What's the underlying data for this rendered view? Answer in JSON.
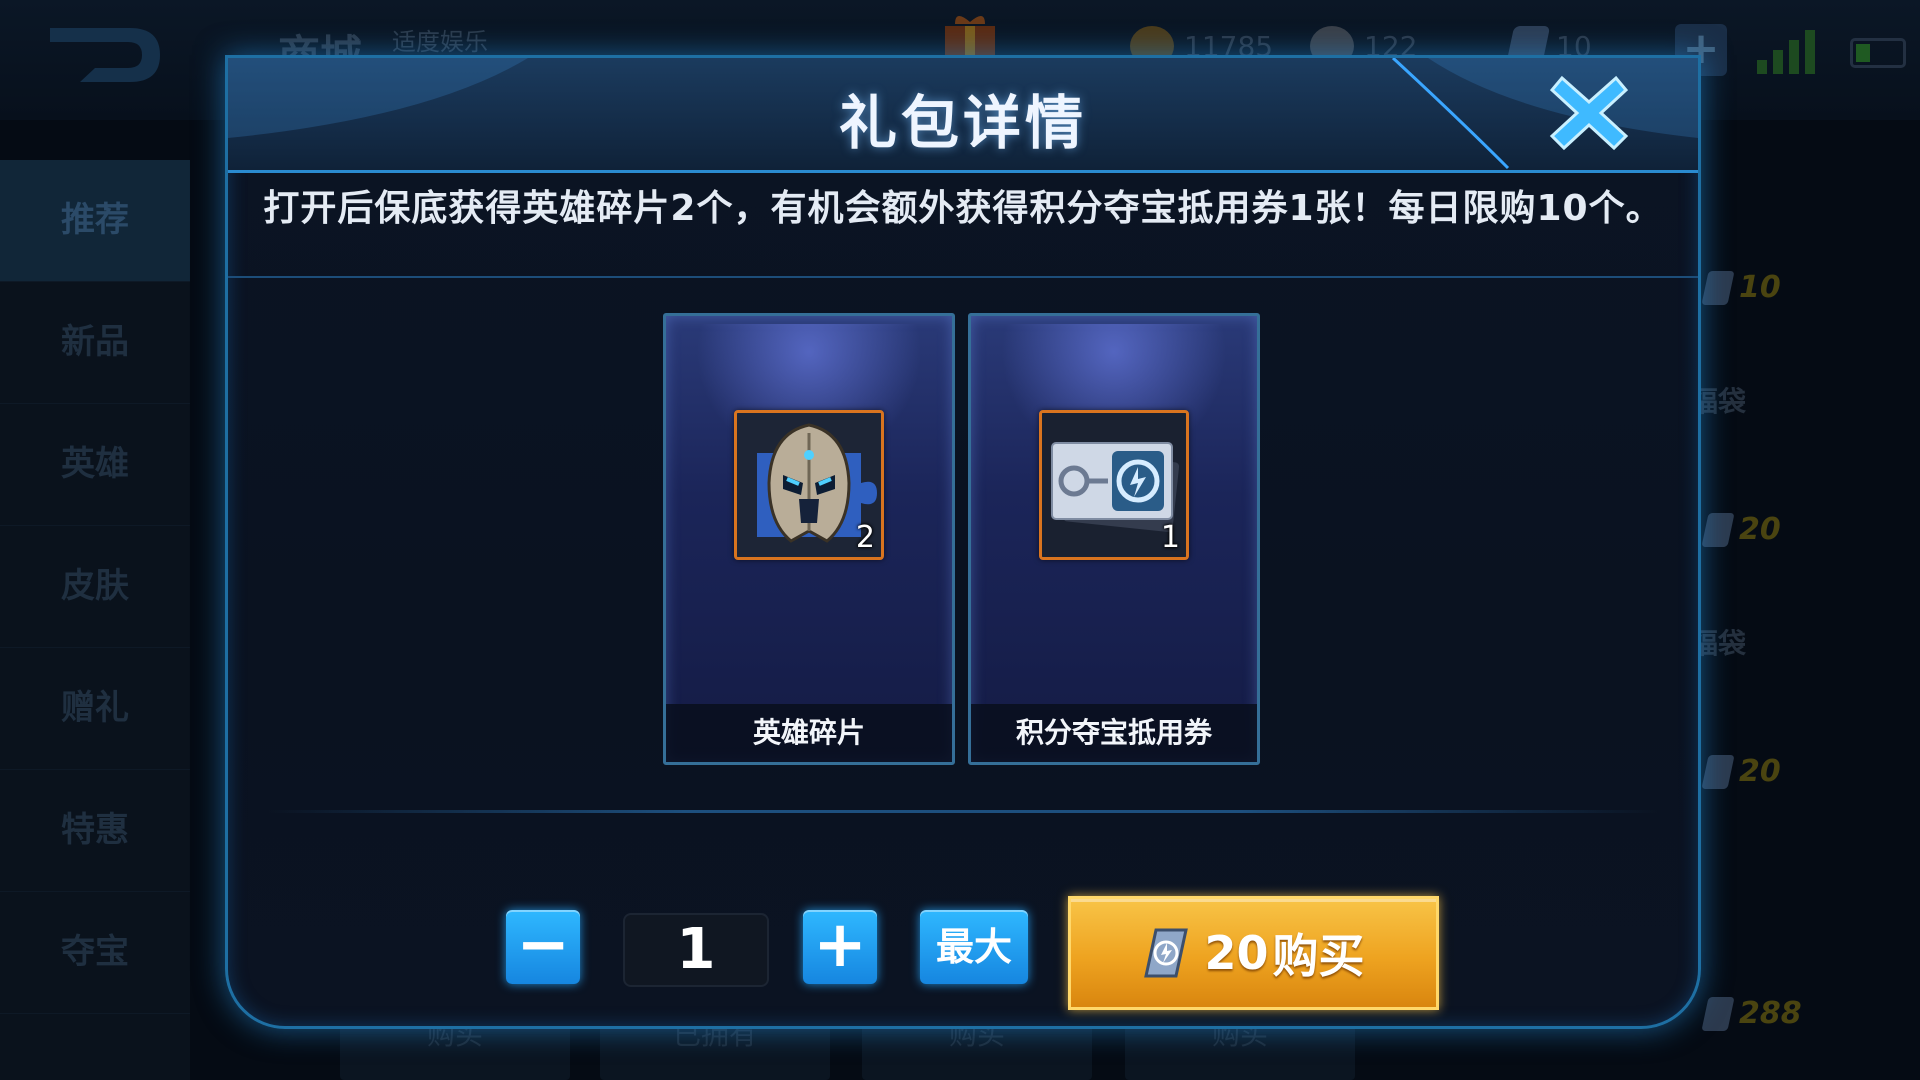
{
  "background": {
    "shop_title": "商城",
    "shop_subtitle": "适度娱乐",
    "resources": [
      {
        "icon": "gold-coin-icon",
        "value": "11785"
      },
      {
        "icon": "skull-icon",
        "value": "122"
      },
      {
        "icon": "ticket-icon",
        "value": "10"
      }
    ],
    "sidebar": [
      "推荐",
      "新品",
      "英雄",
      "皮肤",
      "赠礼",
      "特惠",
      "夺宝"
    ],
    "sidebar_active": "推荐",
    "right_prices": [
      "10",
      "20",
      "20",
      "288"
    ],
    "right_bags": [
      "福袋",
      "福袋"
    ],
    "bottom_tabs": [
      "购买",
      "已拥有",
      "购买",
      "购买"
    ]
  },
  "modal": {
    "title": "礼包详情",
    "description": "打开后保底获得英雄碎片2个，有机会额外获得积分夺宝抵用券1张！每日限购10个。",
    "items": [
      {
        "name": "英雄碎片",
        "count": "2",
        "icon": "hero-fragment-helmet-icon"
      },
      {
        "name": "积分夺宝抵用券",
        "count": "1",
        "icon": "lottery-voucher-ticket-icon"
      }
    ],
    "quantity": "1",
    "minus_label": "−",
    "plus_label": "+",
    "max_label": "最大",
    "buy_price": "20",
    "buy_label": "购买"
  },
  "colors": {
    "accent_blue": "#2fb8ff",
    "buy_gold": "#eea320",
    "item_border_orange": "#d9741f",
    "modal_border": "#1e6fa3"
  }
}
